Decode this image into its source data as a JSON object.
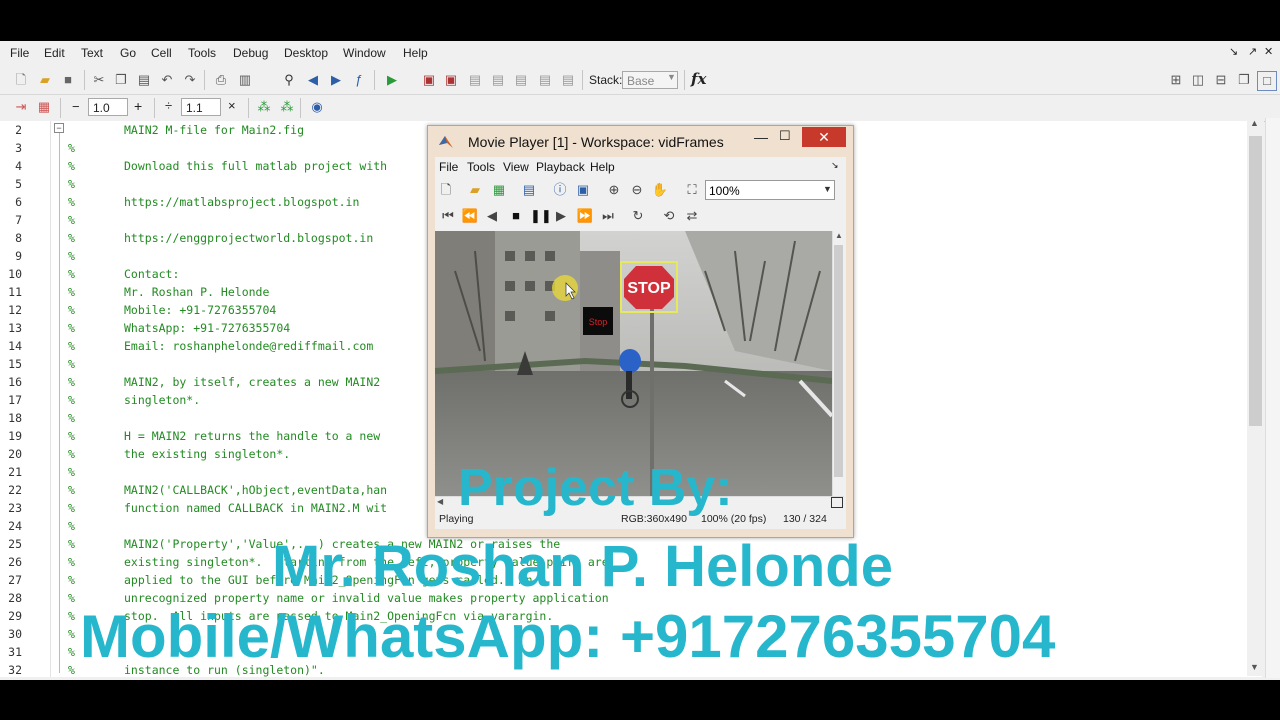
{
  "editor": {
    "menu": [
      "File",
      "Edit",
      "Text",
      "Go",
      "Cell",
      "Tools",
      "Debug",
      "Desktop",
      "Window",
      "Help"
    ],
    "stack_label": "Stack:",
    "stack_value": "Base",
    "fx": "fx",
    "cell_minus_value": "1.0",
    "cell_div_value": "1.1",
    "lines": [
      {
        "n": "2",
        "t": "MAIN2 M-file for Main2.fig"
      },
      {
        "n": "3",
        "t": ""
      },
      {
        "n": "4",
        "t": "Download this full matlab project with"
      },
      {
        "n": "5",
        "t": ""
      },
      {
        "n": "6",
        "t": "https://matlabsproject.blogspot.in"
      },
      {
        "n": "7",
        "t": ""
      },
      {
        "n": "8",
        "t": "https://enggprojectworld.blogspot.in"
      },
      {
        "n": "9",
        "t": ""
      },
      {
        "n": "10",
        "t": "Contact:"
      },
      {
        "n": "11",
        "t": "Mr. Roshan P. Helonde"
      },
      {
        "n": "12",
        "t": "Mobile: +91-7276355704"
      },
      {
        "n": "13",
        "t": "WhatsApp: +91-7276355704"
      },
      {
        "n": "14",
        "t": "Email: roshanphelonde@rediffmail.com"
      },
      {
        "n": "15",
        "t": ""
      },
      {
        "n": "16",
        "t": "MAIN2, by itself, creates a new MAIN2"
      },
      {
        "n": "17",
        "t": "singleton*."
      },
      {
        "n": "18",
        "t": ""
      },
      {
        "n": "19",
        "t": "H = MAIN2 returns the handle to a new"
      },
      {
        "n": "20",
        "t": "the existing singleton*."
      },
      {
        "n": "21",
        "t": ""
      },
      {
        "n": "22",
        "t": "MAIN2('CALLBACK',hObject,eventData,han"
      },
      {
        "n": "23",
        "t": "function named CALLBACK in MAIN2.M wit"
      },
      {
        "n": "24",
        "t": ""
      },
      {
        "n": "25",
        "t": "MAIN2('Property','Value',...) creates a new MAIN2 or raises the"
      },
      {
        "n": "26",
        "t": "existing singleton*.  Starting from the left, property value pairs are"
      },
      {
        "n": "27",
        "t": "applied to the GUI before Main2_OpeningFcn gets called.  An"
      },
      {
        "n": "28",
        "t": "unrecognized property name or invalid value makes property application"
      },
      {
        "n": "29",
        "t": "stop.  All inputs are passed to Main2_OpeningFcn via varargin."
      },
      {
        "n": "30",
        "t": ""
      },
      {
        "n": "31",
        "t": "*See GUI Options on GUIDE's Tools menu.  Choose \"GUI allows only one"
      },
      {
        "n": "32",
        "t": "instance to run (singleton)\"."
      }
    ]
  },
  "movie_player": {
    "title": "Movie Player [1] - Workspace: vidFrames",
    "menu": [
      "File",
      "Tools",
      "View",
      "Playback",
      "Help"
    ],
    "zoom": "100%",
    "sign_text": "STOP",
    "label_text": "Stop",
    "status": {
      "state": "Playing",
      "format": "RGB:360x490",
      "rate": "100% (20 fps)",
      "frame": "130 / 324"
    }
  },
  "overlay": {
    "line1": "Project By:",
    "line2": "Mr. Roshan P. Helonde",
    "line3": "Mobile/WhatsApp: +917276355704"
  },
  "colors": {
    "comment": "#228b22",
    "overlay": "#27b7cc",
    "close": "#c7392b"
  }
}
